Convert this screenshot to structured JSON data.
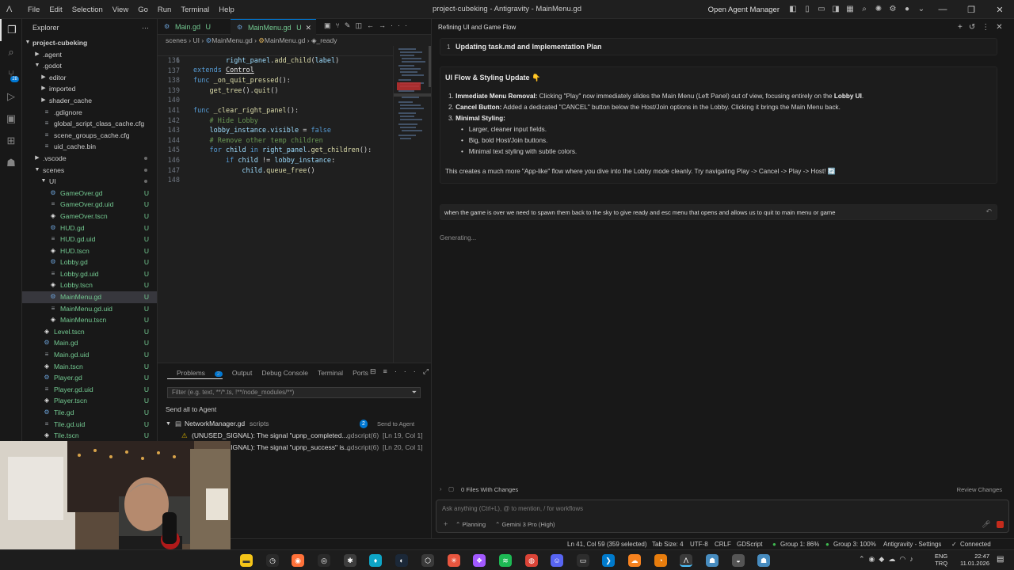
{
  "titlebar": {
    "menu": [
      "File",
      "Edit",
      "Selection",
      "View",
      "Go",
      "Run",
      "Terminal",
      "Help"
    ],
    "title": "project-cubeking - Antigravity - MainMenu.gd",
    "open_agent_manager": "Open Agent Manager"
  },
  "activity": {
    "badge": "28"
  },
  "explorer": {
    "header": "Explorer",
    "root": "project-cubeking",
    "items": [
      {
        "label": ".agent",
        "depth": 1,
        "type": "folder",
        "open": false,
        "status": ""
      },
      {
        "label": ".godot",
        "depth": 1,
        "type": "folder",
        "open": true,
        "status": ""
      },
      {
        "label": "editor",
        "depth": 2,
        "type": "folder",
        "open": false,
        "status": ""
      },
      {
        "label": "imported",
        "depth": 2,
        "type": "folder",
        "open": false,
        "status": ""
      },
      {
        "label": "shader_cache",
        "depth": 2,
        "type": "folder",
        "open": false,
        "status": ""
      },
      {
        "label": ".gdignore",
        "depth": 2,
        "type": "file",
        "status": ""
      },
      {
        "label": "global_script_class_cache.cfg",
        "depth": 2,
        "type": "cfg",
        "status": ""
      },
      {
        "label": "scene_groups_cache.cfg",
        "depth": 2,
        "type": "cfg",
        "status": ""
      },
      {
        "label": "uid_cache.bin",
        "depth": 2,
        "type": "file",
        "status": ""
      },
      {
        "label": ".vscode",
        "depth": 1,
        "type": "folder",
        "open": false,
        "status": "dot"
      },
      {
        "label": "scenes",
        "depth": 1,
        "type": "folder",
        "open": true,
        "status": "dot"
      },
      {
        "label": "UI",
        "depth": 2,
        "type": "folder",
        "open": true,
        "status": "dot"
      },
      {
        "label": "GameOver.gd",
        "depth": 3,
        "type": "gd",
        "status": "U"
      },
      {
        "label": "GameOver.gd.uid",
        "depth": 3,
        "type": "uid",
        "status": "U"
      },
      {
        "label": "GameOver.tscn",
        "depth": 3,
        "type": "tscn",
        "status": "U"
      },
      {
        "label": "HUD.gd",
        "depth": 3,
        "type": "gd",
        "status": "U"
      },
      {
        "label": "HUD.gd.uid",
        "depth": 3,
        "type": "uid",
        "status": "U"
      },
      {
        "label": "HUD.tscn",
        "depth": 3,
        "type": "tscn",
        "status": "U"
      },
      {
        "label": "Lobby.gd",
        "depth": 3,
        "type": "gd",
        "status": "U"
      },
      {
        "label": "Lobby.gd.uid",
        "depth": 3,
        "type": "uid",
        "status": "U"
      },
      {
        "label": "Lobby.tscn",
        "depth": 3,
        "type": "tscn",
        "status": "U"
      },
      {
        "label": "MainMenu.gd",
        "depth": 3,
        "type": "gd",
        "status": "U",
        "selected": true
      },
      {
        "label": "MainMenu.gd.uid",
        "depth": 3,
        "type": "uid",
        "status": "U"
      },
      {
        "label": "MainMenu.tscn",
        "depth": 3,
        "type": "tscn",
        "status": "U"
      },
      {
        "label": "Level.tscn",
        "depth": 2,
        "type": "tscn",
        "status": "U"
      },
      {
        "label": "Main.gd",
        "depth": 2,
        "type": "gd",
        "status": "U"
      },
      {
        "label": "Main.gd.uid",
        "depth": 2,
        "type": "uid",
        "status": "U"
      },
      {
        "label": "Main.tscn",
        "depth": 2,
        "type": "tscn",
        "status": "U"
      },
      {
        "label": "Player.gd",
        "depth": 2,
        "type": "gd",
        "status": "U"
      },
      {
        "label": "Player.gd.uid",
        "depth": 2,
        "type": "uid",
        "status": "U"
      },
      {
        "label": "Player.tscn",
        "depth": 2,
        "type": "tscn",
        "status": "U"
      },
      {
        "label": "Tile.gd",
        "depth": 2,
        "type": "gd",
        "status": "U"
      },
      {
        "label": "Tile.gd.uid",
        "depth": 2,
        "type": "uid",
        "status": "U"
      },
      {
        "label": "Tile.tscn",
        "depth": 2,
        "type": "tscn",
        "status": "U"
      }
    ]
  },
  "editor": {
    "tabs": [
      {
        "label": "Main.gd",
        "status": "U",
        "active": false
      },
      {
        "label": "MainMenu.gd",
        "status": "U",
        "active": true
      }
    ],
    "breadcrumb": [
      "scenes",
      "UI",
      "MainMenu.gd",
      "MainMenu.gd",
      "_ready"
    ],
    "sticky_line": {
      "ln": "1",
      "kw": "extends",
      "cls": "Control"
    },
    "lines": [
      {
        "ln": "136",
        "tokens": [
          [
            "",
            "        "
          ],
          [
            "vr",
            "right_panel"
          ],
          [
            "op",
            "."
          ],
          [
            "fn",
            "add_child"
          ],
          [
            "op",
            "("
          ],
          [
            "vr",
            "label"
          ],
          [
            "op",
            ")"
          ]
        ]
      },
      {
        "ln": "137",
        "tokens": []
      },
      {
        "ln": "138",
        "tokens": [
          [
            "kw",
            "func"
          ],
          [
            "op",
            " "
          ],
          [
            "fn",
            "_on_quit_pressed"
          ],
          [
            "op",
            "():"
          ]
        ]
      },
      {
        "ln": "139",
        "tokens": [
          [
            "",
            "    "
          ],
          [
            "fn",
            "get_tree"
          ],
          [
            "op",
            "()."
          ],
          [
            "fn",
            "quit"
          ],
          [
            "op",
            "()"
          ]
        ]
      },
      {
        "ln": "140",
        "tokens": []
      },
      {
        "ln": "141",
        "tokens": [
          [
            "kw",
            "func"
          ],
          [
            "op",
            " "
          ],
          [
            "fn",
            "_clear_right_panel"
          ],
          [
            "op",
            "():"
          ]
        ]
      },
      {
        "ln": "142",
        "tokens": [
          [
            "",
            "    "
          ],
          [
            "cm",
            "# Hide Lobby"
          ]
        ]
      },
      {
        "ln": "143",
        "tokens": [
          [
            "",
            "    "
          ],
          [
            "vr",
            "lobby_instance"
          ],
          [
            "op",
            "."
          ],
          [
            "vr",
            "visible"
          ],
          [
            "op",
            " = "
          ],
          [
            "kw",
            "false"
          ]
        ]
      },
      {
        "ln": "144",
        "tokens": [
          [
            "",
            "    "
          ],
          [
            "cm",
            "# Remove other temp children"
          ]
        ]
      },
      {
        "ln": "145",
        "tokens": [
          [
            "",
            "    "
          ],
          [
            "kw",
            "for"
          ],
          [
            "op",
            " "
          ],
          [
            "vr",
            "child"
          ],
          [
            "op",
            " "
          ],
          [
            "kw",
            "in"
          ],
          [
            "op",
            " "
          ],
          [
            "vr",
            "right_panel"
          ],
          [
            "op",
            "."
          ],
          [
            "fn",
            "get_children"
          ],
          [
            "op",
            "():"
          ]
        ]
      },
      {
        "ln": "146",
        "tokens": [
          [
            "",
            "        "
          ],
          [
            "kw",
            "if"
          ],
          [
            "op",
            " "
          ],
          [
            "vr",
            "child"
          ],
          [
            "op",
            " != "
          ],
          [
            "vr",
            "lobby_instance"
          ],
          [
            "op",
            ":"
          ]
        ]
      },
      {
        "ln": "147",
        "tokens": [
          [
            "",
            "            "
          ],
          [
            "vr",
            "child"
          ],
          [
            "op",
            "."
          ],
          [
            "fn",
            "queue_free"
          ],
          [
            "op",
            "()"
          ]
        ]
      },
      {
        "ln": "148",
        "tokens": []
      }
    ]
  },
  "panel": {
    "tabs": [
      "Problems",
      "Output",
      "Debug Console",
      "Terminal",
      "Ports"
    ],
    "problems_count": "2",
    "filter_placeholder": "Filter (e.g. text, **/*.ts, !**/node_modules/**)",
    "send_all": "Send all to Agent",
    "file": {
      "name": "NetworkManager.gd",
      "dir": "scripts",
      "count": "2",
      "send": "Send to Agent"
    },
    "problems": [
      {
        "text": "(UNUSED_SIGNAL): The signal \"upnp_completed...",
        "source": "gdscript(6)",
        "loc": "[Ln 19, Col 1]"
      },
      {
        "text": "(UNUSED_SIGNAL): The signal \"upnp_success\" is...",
        "source": "gdscript(6)",
        "loc": "[Ln 20, Col 1]"
      }
    ]
  },
  "agent": {
    "header_title": "Refining UI and Game Flow",
    "step_num": "1",
    "step_title": "Updating task.md and Implementation Plan",
    "update_title": "UI Flow & Styling Update 👇",
    "list": [
      {
        "n": "1.",
        "bold": "Immediate Menu Removal:",
        "text": " Clicking \"Play\" now immediately slides the Main Menu (Left Panel) out of view, focusing entirely on the ",
        "bold2": "Lobby UI",
        "tail": "."
      },
      {
        "n": "2.",
        "bold": "Cancel Button:",
        "text": " Added a dedicated \"CANCEL\" button below the Host/Join options in the Lobby. Clicking it brings the Main Menu back.",
        "bold2": "",
        "tail": ""
      },
      {
        "n": "3.",
        "bold": "Minimal Styling:",
        "text": "",
        "bold2": "",
        "tail": ""
      }
    ],
    "bullets": [
      "Larger, cleaner input fields.",
      "Big, bold Host/Join buttons.",
      "Minimal text styling with subtle colors."
    ],
    "summary": "This creates a much more \"App-like\" flow where you dive into the Lobby mode cleanly. Try navigating Play -> Cancel -> Play -> Host! 🔄",
    "user_message": "when the game is over we need to spawn them back to the sky to give ready and esc menu that opens and allows us to quit to main menu or game",
    "generating": "Generating...",
    "files_changed": "0 Files With Changes",
    "review_changes": "Review Changes",
    "input_placeholder": "Ask anything (Ctrl+L), @ to mention, / for workflows",
    "mode": "Planning",
    "model": "Gemini 3 Pro (High)"
  },
  "statusbar": {
    "position": "Ln 41, Col 59 (359 selected)",
    "tab_size": "Tab Size: 4",
    "encoding": "UTF-8",
    "eol": "CRLF",
    "language": "GDScript",
    "group1": "Group 1: 86%",
    "group3": "Group 3: 100%",
    "settings": "Antigravity - Settings",
    "connected": "Connected"
  },
  "taskbar": {
    "lang": "ENG",
    "region": "TRQ",
    "time": "22:47",
    "date": "11.01.2026"
  }
}
